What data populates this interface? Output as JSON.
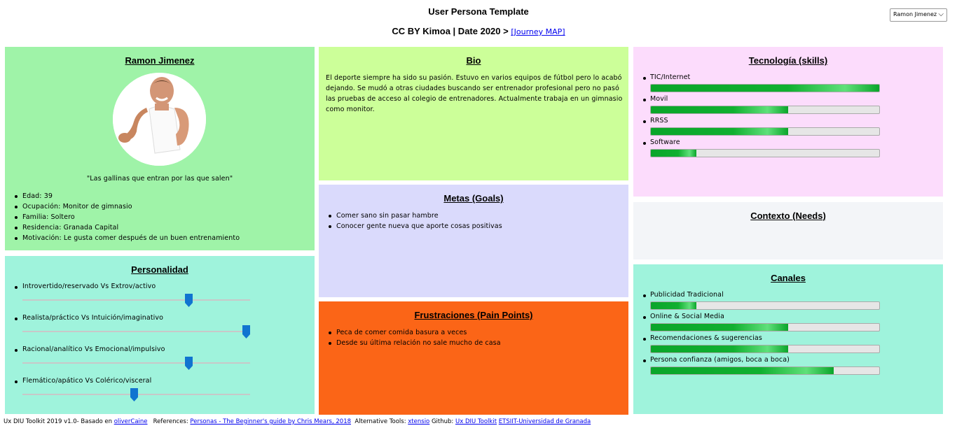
{
  "header": {
    "title": "User Persona Template",
    "subtitle": "CC BY Kimoa | Date 2020 > ",
    "journey_link": "[Journey MAP]",
    "persona_select": "Ramon Jimenez"
  },
  "profile": {
    "name": "Ramon Jimenez",
    "quote": "\"Las gallinas que entran por las que salen\"",
    "details": [
      "Edad: 39",
      "Ocupación: Monitor de gimnasio",
      "Familia: Soltero",
      "Residencia: Granada Capital",
      "Motivación: Le gusta comer después de un buen entrenamiento"
    ]
  },
  "personality": {
    "title": "Personalidad",
    "traits": [
      {
        "label": "Introvertido/reservado Vs Extrov/activo",
        "value": 0.73
      },
      {
        "label": "Realista/práctico Vs Intuición/imaginativo",
        "value": 0.98
      },
      {
        "label": "Racional/analítico Vs Emocional/impulsivo",
        "value": 0.73
      },
      {
        "label": "Flemático/apático Vs Colérico/visceral",
        "value": 0.49
      }
    ]
  },
  "bio": {
    "title": "Bio",
    "text": "El deporte siempre ha sido su pasión. Estuvo en varios equipos de fútbol pero lo acabó dejando. Se mudó a otras ciudades buscando ser entrenador profesional pero no pasó las pruebas de acceso al colegio de entrenadores. Actualmente trabaja en un gimnasio como monitor."
  },
  "goals": {
    "title": "Metas (Goals)",
    "items": [
      "Comer sano sin pasar hambre",
      "Conocer gente nueva que aporte cosas positivas"
    ]
  },
  "frustrations": {
    "title": "Frustraciones (Pain Points)",
    "items": [
      "Peca de comer comida basura a veces",
      "Desde su última relación no sale mucho de casa"
    ]
  },
  "technology": {
    "title": "Tecnología (skills)",
    "items": [
      {
        "label": "TIC/Internet",
        "value": 1.0
      },
      {
        "label": "Movil",
        "value": 0.6
      },
      {
        "label": "RRSS",
        "value": 0.6
      },
      {
        "label": "Software",
        "value": 0.2
      }
    ]
  },
  "context": {
    "title": "Contexto (Needs)"
  },
  "channels": {
    "title": "Canales",
    "items": [
      {
        "label": "Publicidad Tradicional",
        "value": 0.2
      },
      {
        "label": "Online & Social Media",
        "value": 0.6
      },
      {
        "label": "Recomendaciones & sugerencias",
        "value": 0.6
      },
      {
        "label": "Persona confianza (amigos, boca a boca)",
        "value": 0.8
      }
    ]
  },
  "footer": {
    "prefix": "Ux DIU Toolkit 2019 v1.0- Basado en ",
    "oliver_link": "oliverCaine",
    "refs_label": "   References: ",
    "refs_link": "Personas - The Beginner's guide by Chris Mears, 2018",
    "alt_label": "  Alternative Tools: ",
    "alt_link": "xtensio",
    "github_label": " Github: ",
    "github_link": "Ux DIU Toolkit",
    "etsiit_link": "ETSIIT-Universidad de Granada"
  },
  "colors": {
    "profile_bg": "#9ff3a8",
    "personality_bg": "#9ff3dc",
    "bio_bg": "#ccff99",
    "goals_bg": "#dadafc",
    "frustrations_bg": "#fb6517",
    "technology_bg": "#fcdcfc",
    "context_bg": "#f3f5f8",
    "channels_bg": "#9ff3dc",
    "slider_thumb": "#1074d0",
    "bar_fill": "#10b030"
  }
}
